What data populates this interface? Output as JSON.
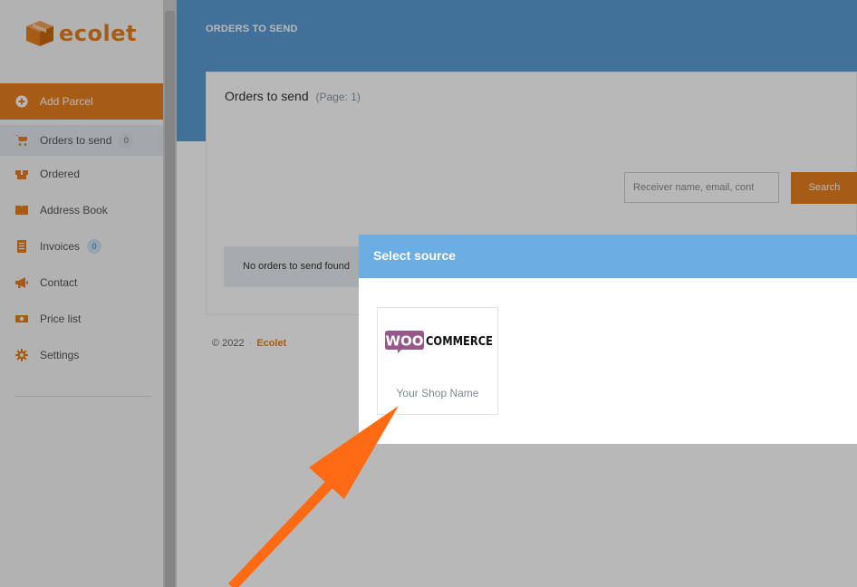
{
  "app": {
    "brand": "ecolet"
  },
  "sidebar": {
    "items": [
      {
        "label": "Add Parcel",
        "icon": "plus-circle-icon"
      },
      {
        "label": "Orders to send",
        "icon": "cart-icon",
        "badge": "0"
      },
      {
        "label": "Ordered",
        "icon": "boxes-icon"
      },
      {
        "label": "Address Book",
        "icon": "book-icon"
      },
      {
        "label": "Invoices",
        "icon": "invoice-icon",
        "badge": "0"
      },
      {
        "label": "Contact",
        "icon": "megaphone-icon"
      },
      {
        "label": "Price list",
        "icon": "money-icon"
      },
      {
        "label": "Settings",
        "icon": "gear-icon"
      }
    ]
  },
  "header": {
    "title": "ORDERS TO SEND"
  },
  "panel": {
    "title": "Orders to send",
    "page_info": "(Page: 1)",
    "search_placeholder": "Receiver name, email, cont",
    "search_button": "Search",
    "empty_message": "No orders to send found"
  },
  "footer": {
    "copyright": "© 2022",
    "separator": "·",
    "brand": "Ecolet"
  },
  "modal": {
    "title": "Select source",
    "sources": [
      {
        "logo_text_woo": "WOO",
        "logo_text_commerce": "COMMERCE",
        "name": "Your Shop Name"
      }
    ]
  },
  "colors": {
    "accent": "#e8801e",
    "header_blue": "#5b9bd5",
    "modal_header": "#6aaee4",
    "woo_purple": "#96588a",
    "annotation_arrow": "#ff6a13"
  }
}
